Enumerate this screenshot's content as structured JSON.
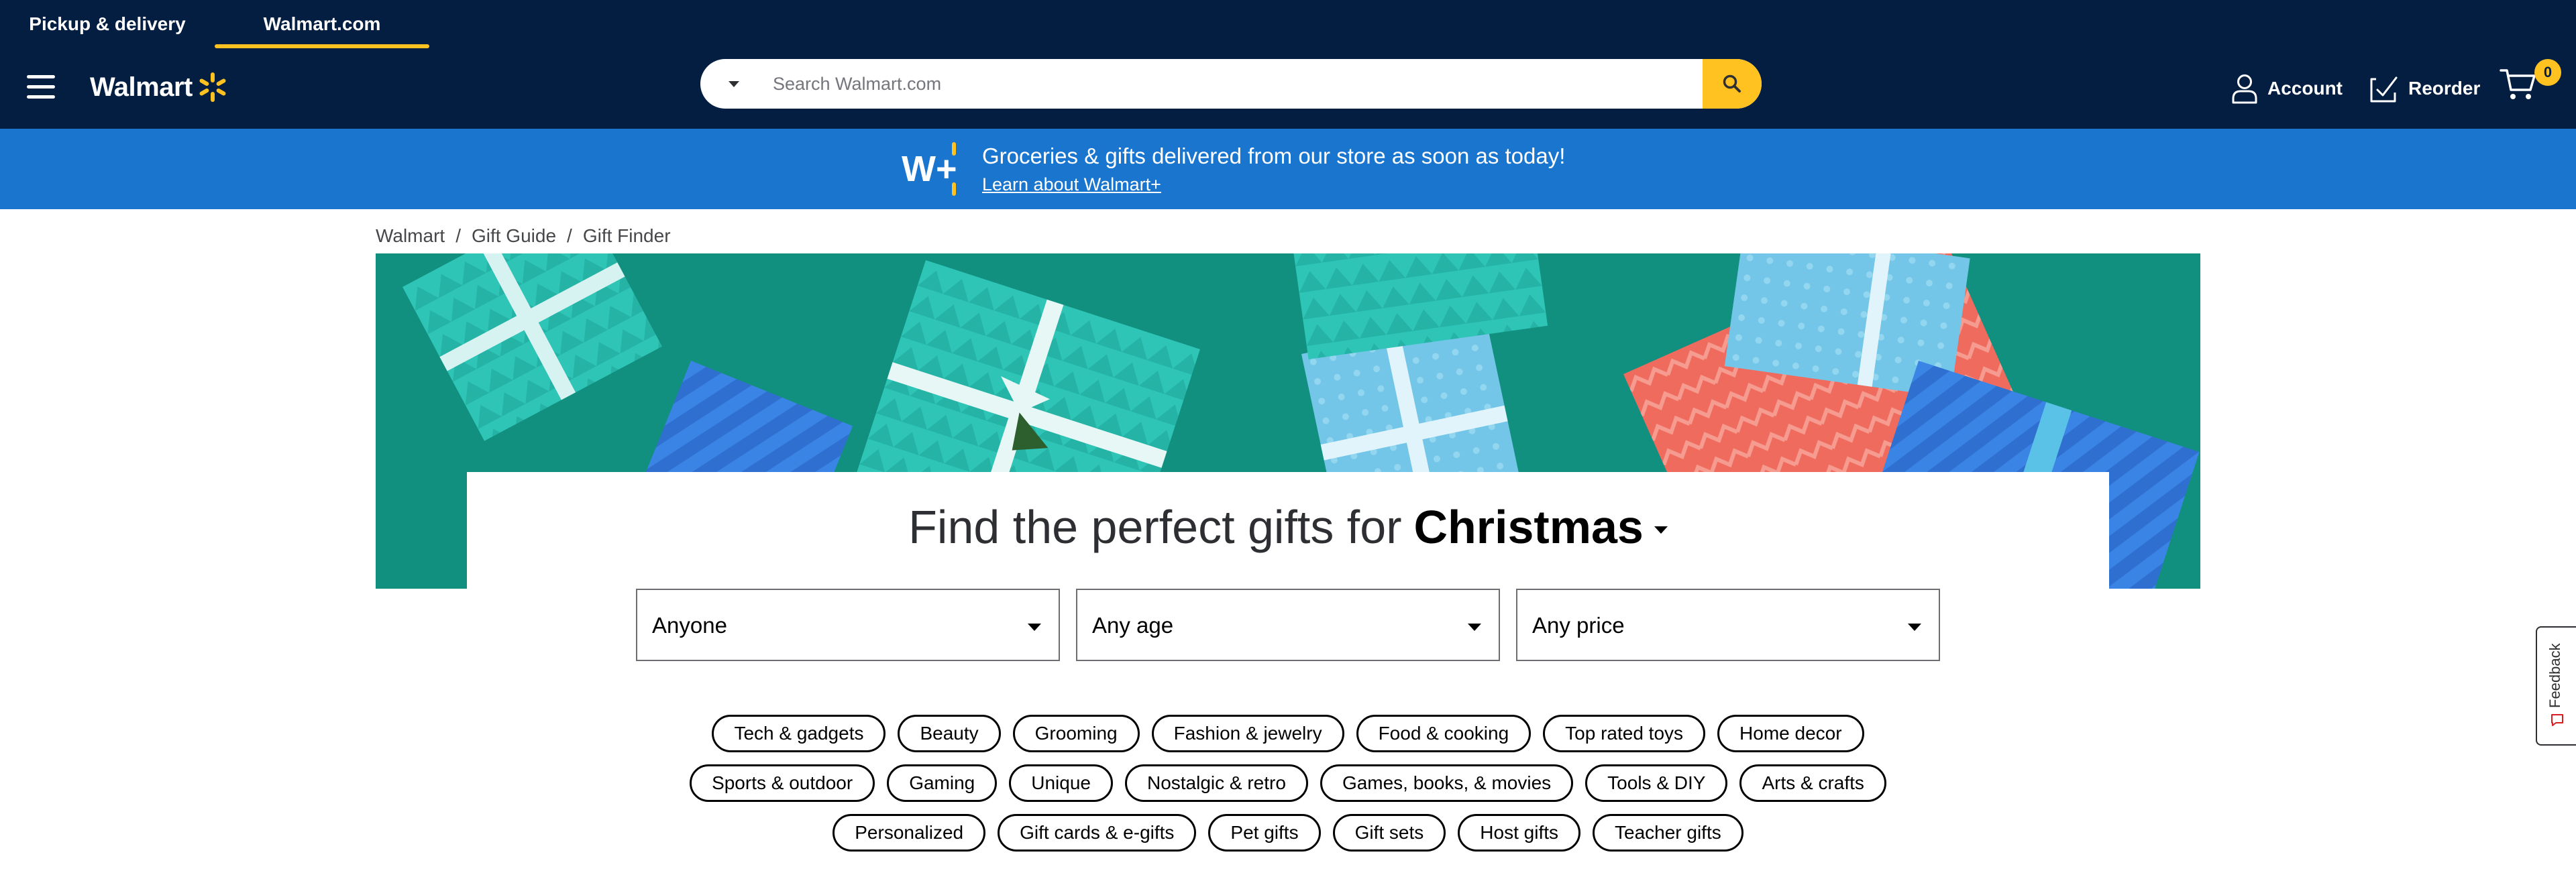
{
  "mode_tabs": [
    {
      "label": "Pickup & delivery",
      "active": false
    },
    {
      "label": "Walmart.com",
      "active": true
    }
  ],
  "header": {
    "logo_text": "Walmart",
    "search_placeholder": "Search Walmart.com",
    "account_label": "Account",
    "reorder_label": "Reorder",
    "cart_count": "0"
  },
  "wplus": {
    "logo_text": "W+",
    "message": "Groceries & gifts delivered from our store as soon as today!",
    "link": "Learn about Walmart+"
  },
  "breadcrumb": [
    "Walmart",
    "Gift Guide",
    "Gift Finder"
  ],
  "finder": {
    "title_prefix": "Find the perfect gifts for",
    "occasion": "Christmas",
    "selects": [
      "Anyone",
      "Any age",
      "Any price"
    ]
  },
  "chips": [
    [
      "Tech & gadgets",
      "Beauty",
      "Grooming",
      "Fashion & jewelry",
      "Food & cooking",
      "Top rated toys",
      "Home decor"
    ],
    [
      "Sports & outdoor",
      "Gaming",
      "Unique",
      "Nostalgic & retro",
      "Games, books, & movies",
      "Tools & DIY",
      "Arts & crafts"
    ],
    [
      "Personalized",
      "Gift cards & e-gifts",
      "Pet gifts",
      "Gift sets",
      "Host gifts",
      "Teacher gifts"
    ]
  ],
  "feedback_label": "Feedback",
  "colors": {
    "navy": "#041e42",
    "spark_yellow": "#ffc220",
    "wplus_blue": "#1a75cf",
    "hero_green": "#11907f"
  }
}
